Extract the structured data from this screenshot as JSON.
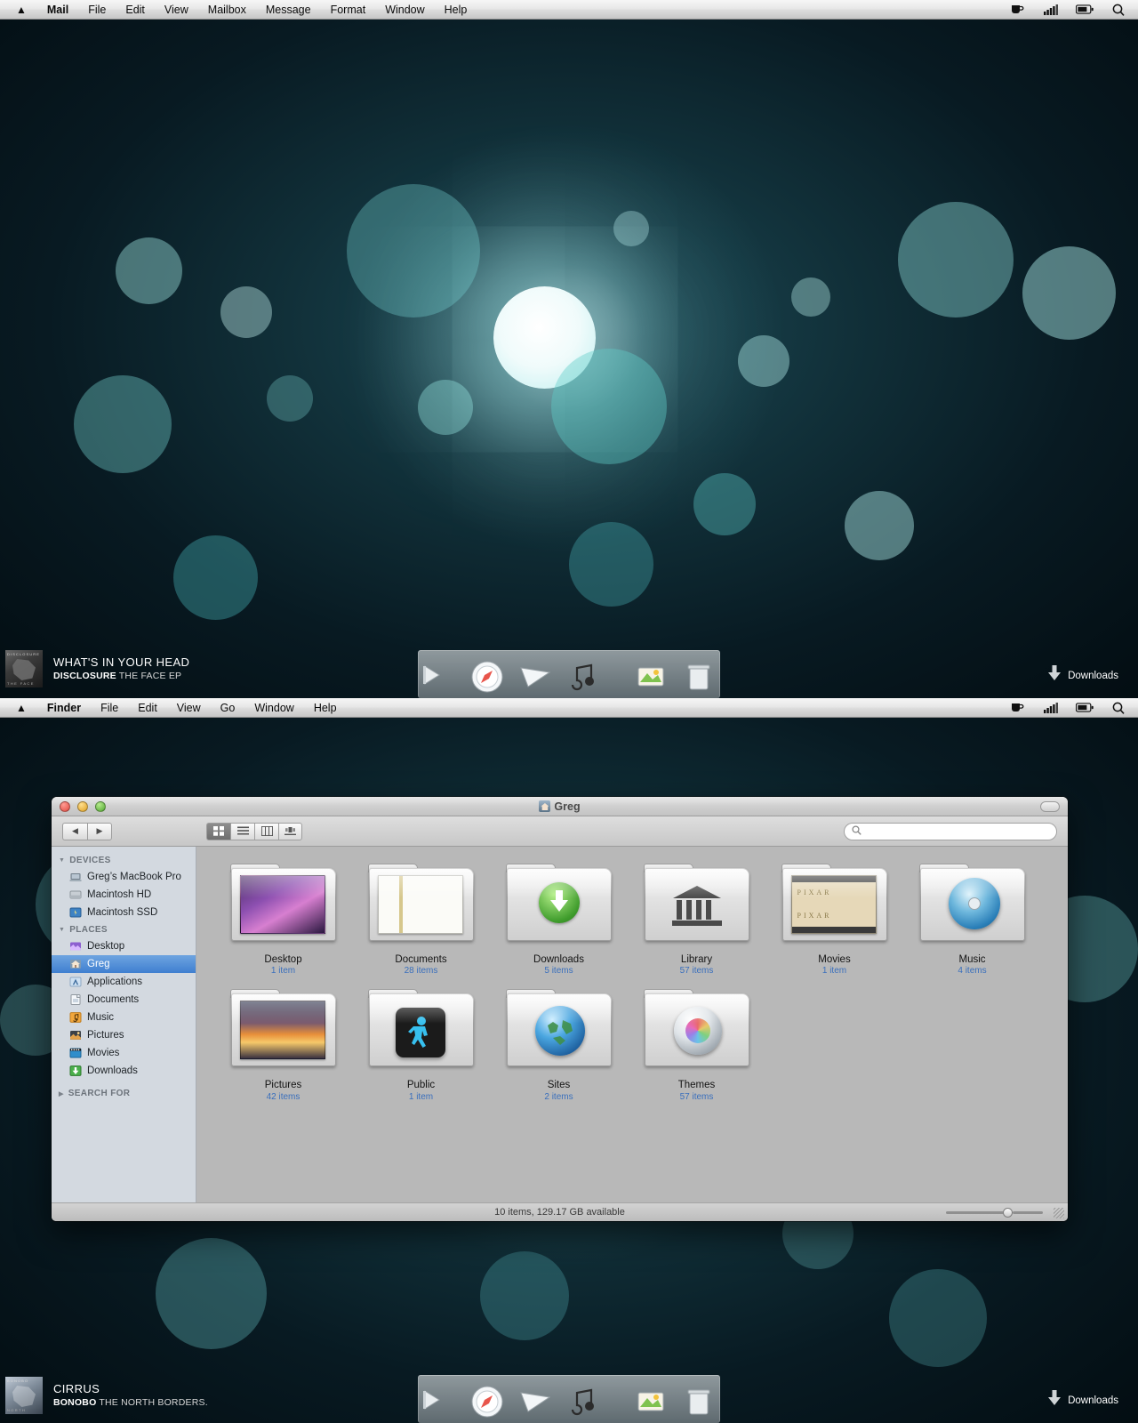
{
  "menubars": [
    {
      "app": "Mail",
      "items": [
        "Mail",
        "File",
        "Edit",
        "View",
        "Mailbox",
        "Message",
        "Format",
        "Window",
        "Help"
      ],
      "status_icons": [
        "coffee-cup-icon",
        "wifi-signal-icon",
        "battery-icon",
        "spotlight-search-icon"
      ]
    },
    {
      "app": "Finder",
      "items": [
        "Finder",
        "File",
        "Edit",
        "View",
        "Go",
        "Window",
        "Help"
      ],
      "status_icons": [
        "coffee-cup-icon",
        "wifi-signal-icon",
        "battery-icon",
        "spotlight-search-icon"
      ]
    }
  ],
  "now_playing": [
    {
      "title": "WHAT'S IN YOUR HEAD",
      "artist": "DISCLOSURE",
      "album": "THE FACE EP",
      "art_tag": "DISCLOSURE",
      "art_tag_bottom": "THE FACE"
    },
    {
      "title": "CIRRUS",
      "artist": "BONOBO",
      "album": "THE NORTH BORDERS.",
      "art_tag": "BONOBO",
      "art_tag_bottom": "NORTH"
    }
  ],
  "downloads_stack": {
    "label": "Downloads",
    "icon": "download-arrow-icon"
  },
  "dock": {
    "items": [
      {
        "name": "finder-icon",
        "label": "Finder"
      },
      {
        "name": "safari-icon",
        "label": "Safari"
      },
      {
        "name": "mail-icon",
        "label": "Mail"
      },
      {
        "name": "itunes-icon",
        "label": "iTunes"
      },
      {
        "name": "preview-icon",
        "label": "Preview"
      },
      {
        "name": "trash-icon",
        "label": "Trash"
      }
    ]
  },
  "finder_window": {
    "title": "Greg",
    "title_icon": "home-folder-icon",
    "nav": {
      "back": "◀",
      "forward": "▶"
    },
    "view_modes": [
      {
        "name": "icon-view",
        "selected": true
      },
      {
        "name": "list-view",
        "selected": false
      },
      {
        "name": "column-view",
        "selected": false
      },
      {
        "name": "coverflow-view",
        "selected": false
      }
    ],
    "search": {
      "placeholder": "",
      "value": "",
      "icon": "search-icon"
    },
    "sidebar": [
      {
        "header": "DEVICES",
        "items": [
          {
            "label": "Greg’s MacBook Pro",
            "icon": "laptop-icon",
            "selected": false
          },
          {
            "label": "Macintosh HD",
            "icon": "hard-drive-icon",
            "selected": false
          },
          {
            "label": "Macintosh SSD",
            "icon": "ssd-drive-icon",
            "selected": false
          }
        ]
      },
      {
        "header": "PLACES",
        "items": [
          {
            "label": "Desktop",
            "icon": "desktop-icon",
            "selected": false
          },
          {
            "label": "Greg",
            "icon": "home-icon",
            "selected": true
          },
          {
            "label": "Applications",
            "icon": "applications-icon",
            "selected": false
          },
          {
            "label": "Documents",
            "icon": "documents-icon",
            "selected": false
          },
          {
            "label": "Music",
            "icon": "music-icon",
            "selected": false
          },
          {
            "label": "Pictures",
            "icon": "pictures-icon",
            "selected": false
          },
          {
            "label": "Movies",
            "icon": "movies-icon",
            "selected": false
          },
          {
            "label": "Downloads",
            "icon": "downloads-icon",
            "selected": false
          }
        ]
      },
      {
        "header": "SEARCH FOR",
        "items": []
      }
    ],
    "files": [
      {
        "label": "Desktop",
        "count": "1 item",
        "icon": "desktop-folder-icon"
      },
      {
        "label": "Documents",
        "count": "28 items",
        "icon": "documents-folder-icon"
      },
      {
        "label": "Downloads",
        "count": "5 items",
        "icon": "downloads-folder-icon"
      },
      {
        "label": "Library",
        "count": "57 items",
        "icon": "library-folder-icon"
      },
      {
        "label": "Movies",
        "count": "1 item",
        "icon": "movies-folder-icon"
      },
      {
        "label": "Music",
        "count": "4 items",
        "icon": "music-folder-icon"
      },
      {
        "label": "Pictures",
        "count": "42 items",
        "icon": "pictures-folder-icon"
      },
      {
        "label": "Public",
        "count": "1 item",
        "icon": "public-folder-icon"
      },
      {
        "label": "Sites",
        "count": "2 items",
        "icon": "sites-folder-icon"
      },
      {
        "label": "Themes",
        "count": "57 items",
        "icon": "themes-folder-icon"
      }
    ],
    "status": "10 items, 129.17 GB available",
    "zoom_value": "55"
  },
  "colors": {
    "selection_blue": "#3f7fd0",
    "count_blue": "#3a6fbc",
    "sidebar_bg": "#d3d9e0",
    "content_bg": "#b8b8b8",
    "desktop_teal": "#1d4c58"
  }
}
